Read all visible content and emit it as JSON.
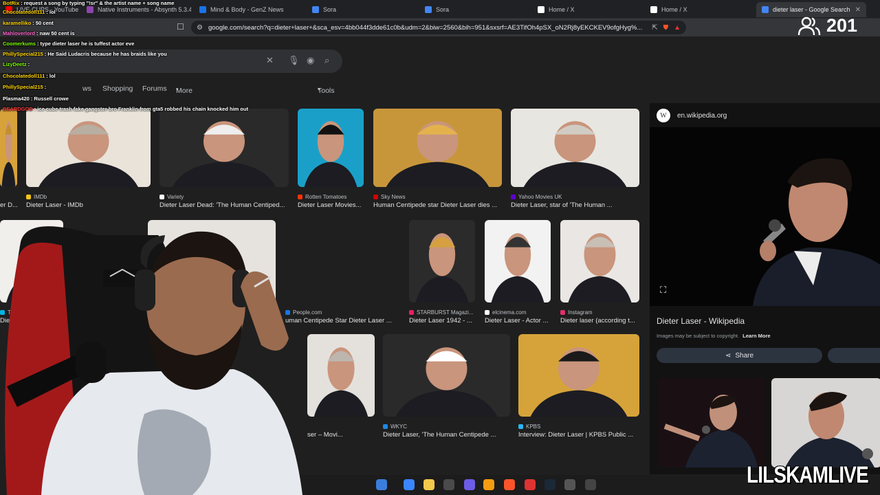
{
  "browser": {
    "tabs": [
      {
        "label": "LIVE CUPS - YouTube",
        "fav": "#ff0000"
      },
      {
        "label": "Native Instruments - Absynth 5.3.4",
        "fav": "#8e44ad"
      },
      {
        "label": "Mind & Body - GenZ News",
        "fav": "#1a73e8"
      },
      {
        "label": "Sora",
        "fav": "#4285f4"
      },
      {
        "label": "Sora",
        "fav": "#4285f4"
      },
      {
        "label": "Home / X",
        "fav": "#ffffff"
      },
      {
        "label": "Home / X",
        "fav": "#ffffff"
      },
      {
        "label": "dieter laser - Google Search",
        "fav": "#4285f4",
        "close": "✕"
      }
    ],
    "url": "google.com/search?q=dieter+laser+&sca_esv=4bb044f3dde61c0b&udm=2&biw=2560&bih=951&sxsrf=AE3TifOh4pSX_oN2Rj8yEKCKEV9ofgHyg%..."
  },
  "viewer_count": "201",
  "search": {
    "tabs": {
      "shopping": "Shopping",
      "forums": "Forums",
      "more": "More",
      "tools": "Tools",
      "news_partial": "ws"
    }
  },
  "chat": [
    {
      "user": "BotRix",
      "color": "#ffd400",
      "msg": ": request a song by typing \"!sr\" & the artist name + song name"
    },
    {
      "user": "Chocolatedoll111",
      "color": "#ffd400",
      "msg": ": lol"
    },
    {
      "user": "karamelliko",
      "color": "#ffd400",
      "msg": ": 50 cent"
    },
    {
      "user": "Mahloverlord",
      "color": "#ff66cc",
      "msg": ": naw 50 cent is"
    },
    {
      "user": "Coomerkums",
      "color": "#7CFC00",
      "msg": ": type dieter laser he is tuffest actor eve"
    },
    {
      "user": "PhillySpecial215",
      "color": "#ffd400",
      "msg": ": He Said Ludacris because he has braids like you"
    },
    {
      "user": "LizyDeetz",
      "color": "#7CFC00",
      "msg": ":"
    },
    {
      "user": "Chocolatedoll111",
      "color": "#ffd400",
      "msg": ": lol"
    },
    {
      "user": "PhillySpecial215",
      "color": "#ffd400",
      "msg": ":"
    },
    {
      "user": "Plasma420",
      "color": "#ffffff",
      "msg": ": Russell crowe"
    },
    {
      "user": "BEARDGOD",
      "color": "#ff3b3b",
      "msg": ": ice cube trash fake gangster bro Franklin from gta5 robbed his chain knocked him out"
    }
  ],
  "results": {
    "row1": [
      {
        "source": "",
        "title": "er D..."
      },
      {
        "source": "IMDb",
        "title": "Dieter Laser - IMDb",
        "dot": "#f5c518"
      },
      {
        "source": "Variety",
        "title": "Dieter Laser Dead: 'The Human Centiped...",
        "dot": "#ffffff"
      },
      {
        "source": "Rotten Tomatoes",
        "title": "Dieter Laser Movies...",
        "dot": "#fa320a"
      },
      {
        "source": "Sky News",
        "title": "Human Centipede star Dieter Laser dies ...",
        "dot": "#d40000"
      },
      {
        "source": "Yahoo Movies UK",
        "title": "Dieter Laser, star of 'The Human ...",
        "dot": "#6001d2"
      }
    ],
    "row2": [
      {
        "source": "TMDB",
        "title": "Dieter Lase",
        "dot": "#01b4e4"
      },
      {
        "source": "People.com",
        "title": "uman Centipede Star Dieter Laser ...",
        "dot": "#1a73e8"
      },
      {
        "source": "STARBURST Magazi...",
        "title": "Dieter Laser 1942 - ...",
        "dot": "#e91e63"
      },
      {
        "source": "elcinema.com",
        "title": "Dieter Laser - Actor ...",
        "dot": "#ffffff"
      },
      {
        "source": "Instagram",
        "title": "Dieter laser (according t...",
        "dot": "#e1306c"
      }
    ],
    "row3": [
      {
        "source": "",
        "title": "ser – Movi..."
      },
      {
        "source": "WKYC",
        "title": "Dieter Laser, 'The Human Centipede ...",
        "dot": "#1e88e5"
      },
      {
        "source": "KPBS",
        "title": "Interview: Dieter Laser | KPBS Public ...",
        "dot": "#29b6f6"
      }
    ]
  },
  "panel": {
    "source": "en.wikipedia.org",
    "title": "Dieter Laser - Wikipedia",
    "copyright": "Images may be subject to copyright.",
    "learn_more": "Learn More",
    "share": "Share"
  },
  "watermark": "LILSKAMLIVE"
}
